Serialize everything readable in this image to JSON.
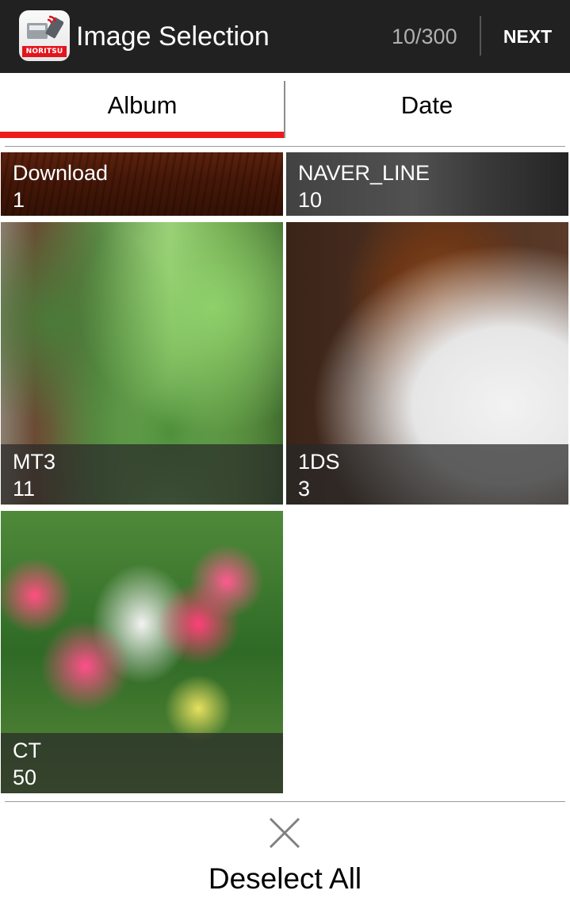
{
  "actionbar": {
    "app_brand": "NORITSU",
    "title": "Image Selection",
    "counter": "10/300",
    "next_label": "NEXT",
    "background": "#212121"
  },
  "tabs": [
    {
      "label": "Album",
      "active": true
    },
    {
      "label": "Date",
      "active": false
    }
  ],
  "accent_color": "#ee1b1b",
  "albums": [
    {
      "name": "Download",
      "count": "1"
    },
    {
      "name": "NAVER_LINE",
      "count": "10"
    },
    {
      "name": "MT3",
      "count": "11"
    },
    {
      "name": "1DS",
      "count": "3"
    },
    {
      "name": "CT",
      "count": "50"
    }
  ],
  "bottom": {
    "icon": "close-icon",
    "deselect_label": "Deselect All"
  }
}
